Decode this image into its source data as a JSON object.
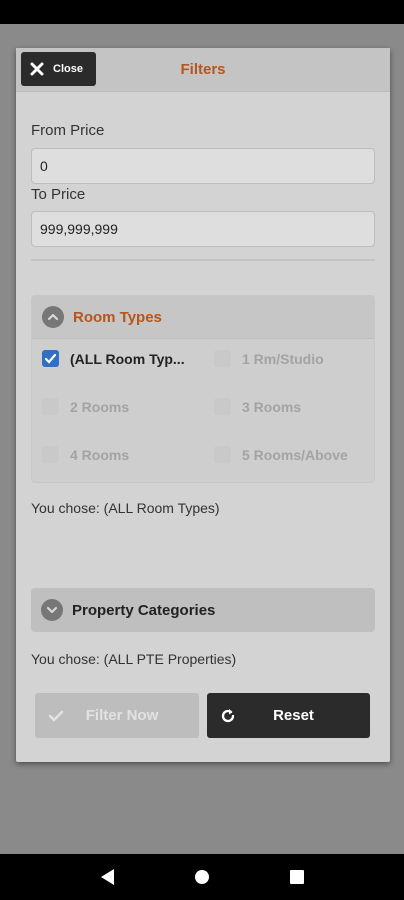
{
  "dialog": {
    "title": "Filters",
    "close_label": "Close"
  },
  "price": {
    "from_label": "From Price",
    "from_value": "0",
    "to_label": "To Price",
    "to_value": "999,999,999"
  },
  "room_types": {
    "header": "Room Types",
    "expanded": true,
    "options": [
      {
        "label": "(ALL Room Typ...",
        "checked": true
      },
      {
        "label": "1 Rm/Studio",
        "checked": false
      },
      {
        "label": "2 Rooms",
        "checked": false
      },
      {
        "label": "3 Rooms",
        "checked": false
      },
      {
        "label": "4 Rooms",
        "checked": false
      },
      {
        "label": "5 Rooms/Above",
        "checked": false
      }
    ],
    "chosen_text": "You chose: (ALL Room Types)"
  },
  "property_categories": {
    "header": "Property Categories",
    "expanded": false,
    "chosen_text": "You chose: (ALL PTE Properties)"
  },
  "buttons": {
    "filter_label": "Filter Now",
    "reset_label": "Reset"
  },
  "colors": {
    "accent": "#b5561d",
    "checkbox": "#2f6fc4",
    "dark_button": "#2b2b2b"
  }
}
